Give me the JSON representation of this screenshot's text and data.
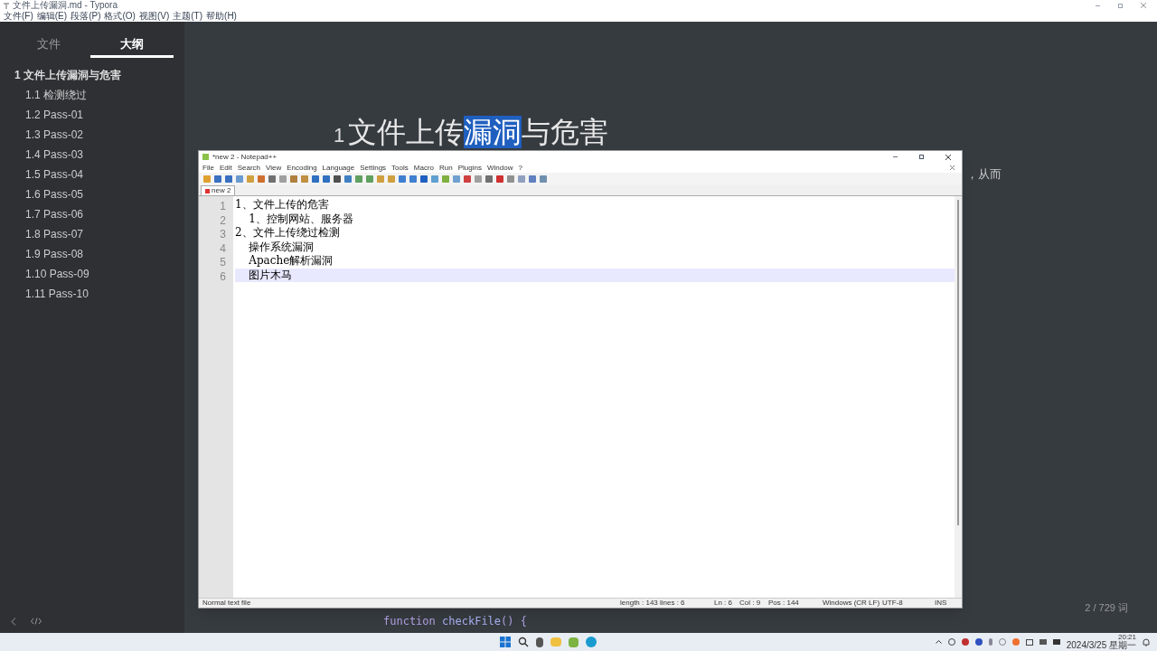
{
  "window": {
    "title": "文件上传漏洞.md - Typora",
    "menu": [
      "文件(F)",
      "编辑(E)",
      "段落(P)",
      "格式(O)",
      "视图(V)",
      "主题(T)",
      "帮助(H)"
    ]
  },
  "sidebar": {
    "tabs": [
      {
        "label": "文件",
        "selected": false
      },
      {
        "label": "大纲",
        "selected": true
      }
    ],
    "outline": [
      {
        "label": "1 文件上传漏洞与危害",
        "selected": false,
        "children": [
          {
            "label": "1.1 检测绕过"
          },
          {
            "label": "1.2 Pass-01"
          },
          {
            "label": "1.3 Pass-02"
          },
          {
            "label": "1.4 Pass-03"
          },
          {
            "label": "1.5 Pass-04"
          },
          {
            "label": "1.6 Pass-05"
          },
          {
            "label": "1.7 Pass-06"
          },
          {
            "label": "1.8 Pass-07"
          },
          {
            "label": "1.9 Pass-08"
          },
          {
            "label": "1.10 Pass-09"
          },
          {
            "label": "1.11 Pass-10"
          }
        ]
      }
    ]
  },
  "document": {
    "heading": {
      "number": "1",
      "before": "文件上传",
      "selected": "漏洞",
      "after": "与危害"
    },
    "text_fragment": "，从而",
    "code_line": {
      "keyword": "function",
      "name": "checkFile",
      "rest": "() {"
    },
    "word_count": "2 / 729 词"
  },
  "notepad": {
    "title": "*new 2 - Notepad++",
    "menu": [
      "File",
      "Edit",
      "Search",
      "View",
      "Encoding",
      "Language",
      "Settings",
      "Tools",
      "Macro",
      "Run",
      "Plugins",
      "Window",
      "?"
    ],
    "tab": "new 2",
    "lines": [
      {
        "number": "1",
        "text": "1、文件上传的危害",
        "current": false
      },
      {
        "number": "2",
        "text": "    1、控制网站、服务器",
        "current": false
      },
      {
        "number": "3",
        "text": "2、文件上传绕过检测",
        "current": false
      },
      {
        "number": "4",
        "text": "    操作系统漏洞",
        "current": false
      },
      {
        "number": "5",
        "text": "    Apache解析漏洞",
        "current": false
      },
      {
        "number": "6",
        "text": "    图片木马",
        "current": true
      }
    ],
    "status": {
      "type": "Normal text file",
      "length": "length : 143",
      "lines": "lines : 6",
      "ln": "Ln : 6",
      "col": "Col : 9",
      "pos": "Pos : 144",
      "eol": "Windows (CR LF)",
      "encoding": "UTF-8",
      "mode": "INS"
    }
  },
  "taskbar": {
    "time": "20:21",
    "date": "2024/3/25 星期一"
  }
}
